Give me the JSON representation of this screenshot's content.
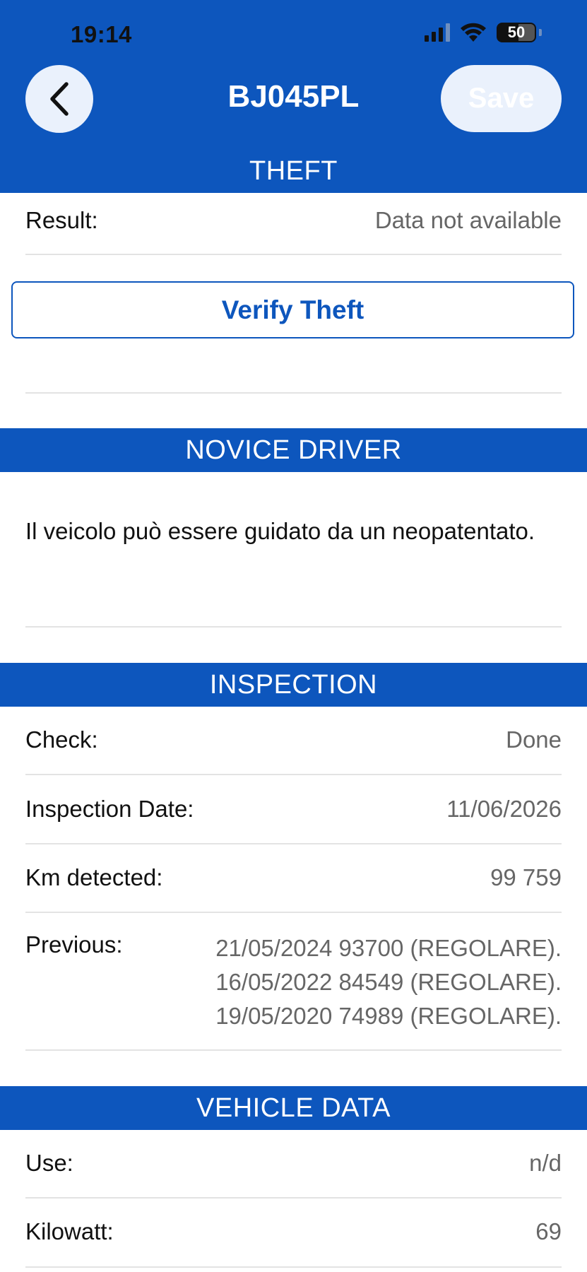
{
  "status_bar": {
    "time": "19:14",
    "battery": "50"
  },
  "nav": {
    "title": "BJ045PL",
    "save_label": "Save"
  },
  "theft": {
    "header": "THEFT",
    "result_label": "Result:",
    "result_value": "Data not available",
    "verify_label": "Verify Theft"
  },
  "novice": {
    "header": "NOVICE DRIVER",
    "text": "Il veicolo può essere guidato da un neopatentato."
  },
  "inspection": {
    "header": "INSPECTION",
    "check_label": "Check:",
    "check_value": "Done",
    "date_label": "Inspection Date:",
    "date_value": "11/06/2026",
    "km_label": "Km detected:",
    "km_value": "99 759",
    "previous_label": "Previous:",
    "previous_values": [
      "21/05/2024 93700 (REGOLARE).",
      "16/05/2022 84549 (REGOLARE).",
      "19/05/2020 74989 (REGOLARE)."
    ]
  },
  "vehicle": {
    "header": "VEHICLE DATA",
    "use_label": "Use:",
    "use_value": "n/d",
    "kw_label": "Kilowatt:",
    "kw_value": "69"
  }
}
